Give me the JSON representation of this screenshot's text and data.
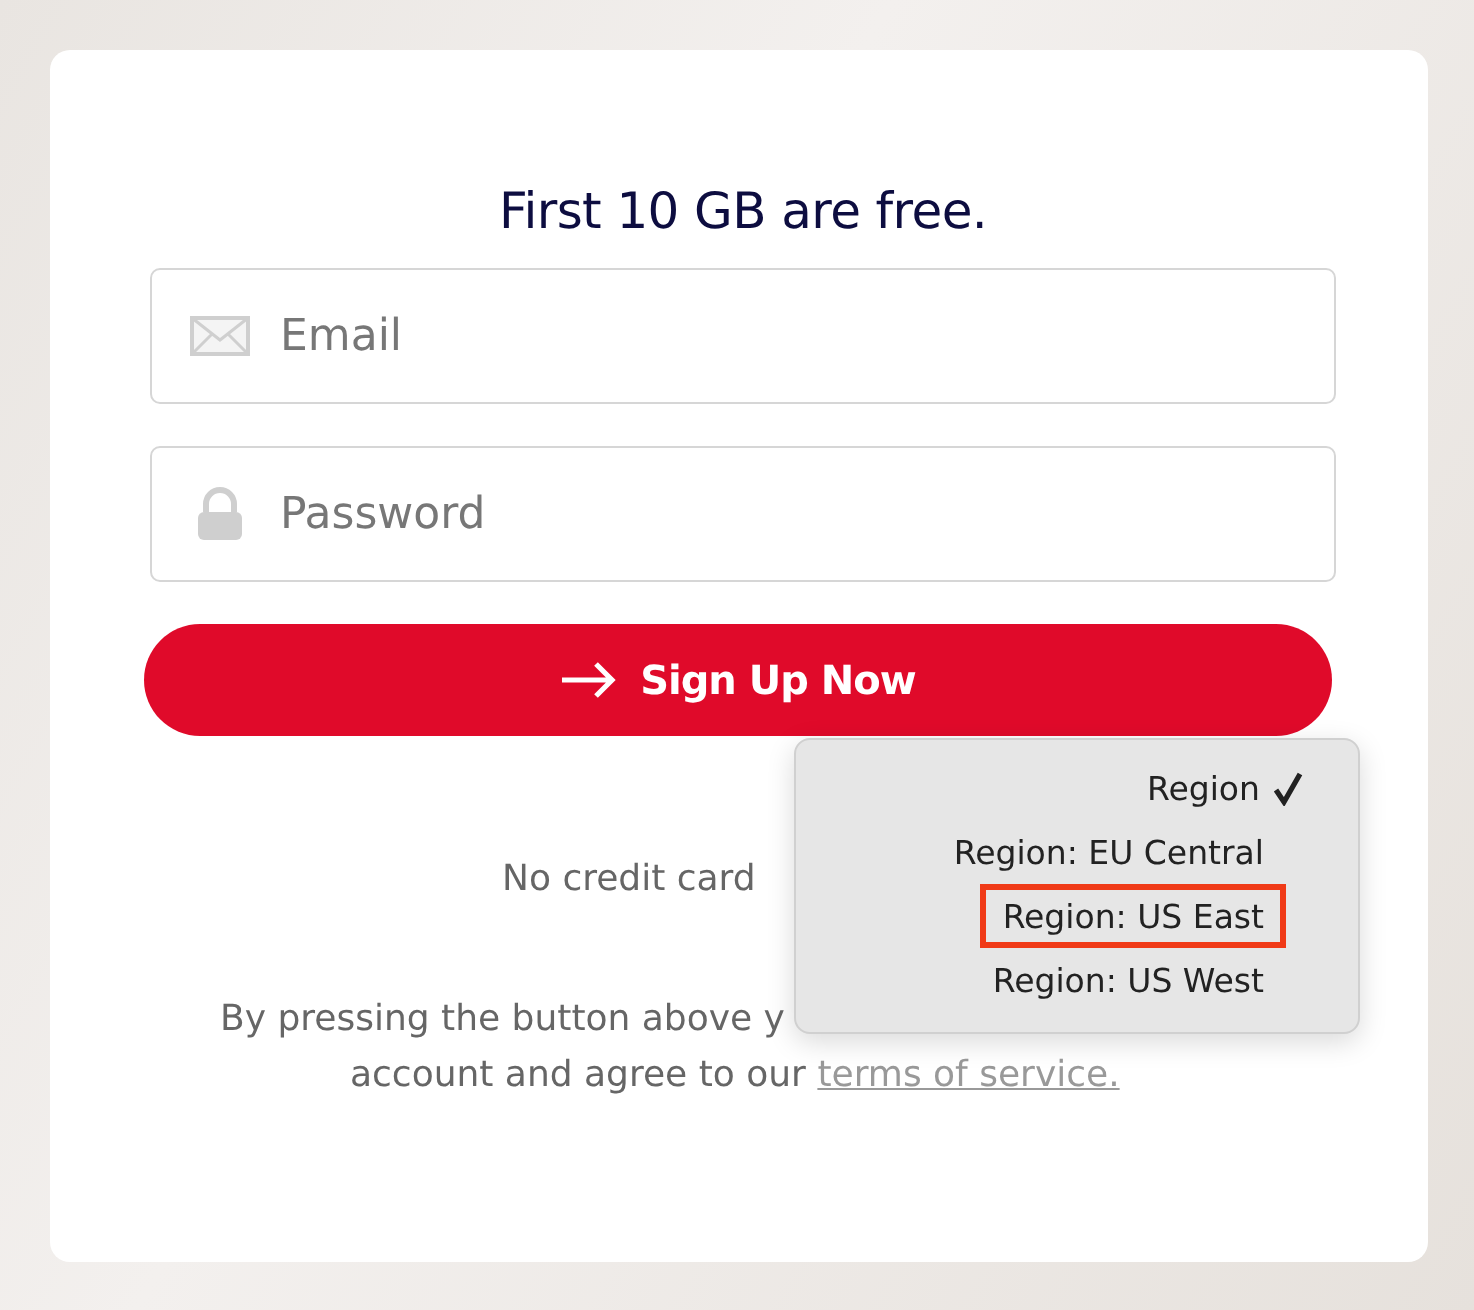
{
  "title": "First 10 GB are free.",
  "fields": [
    {
      "kind": "email",
      "placeholder": "Email"
    },
    {
      "kind": "password",
      "placeholder": "Password"
    }
  ],
  "submit": {
    "label": "Sign Up Now"
  },
  "notes": [
    {
      "kind": "note",
      "text": "No credit card"
    },
    {
      "kind": "terms",
      "text": "By pressing the button above y"
    },
    {
      "kind": "terms-end",
      "text": "account and agree to our ",
      "link": "terms of service."
    }
  ],
  "region_menu": {
    "items": [
      {
        "label": "Region",
        "checked": true,
        "highlighted": false
      },
      {
        "label": "Region: EU Central",
        "checked": false,
        "highlighted": false
      },
      {
        "label": "Region: US East",
        "checked": false,
        "highlighted": true
      },
      {
        "label": "Region: US West",
        "checked": false,
        "highlighted": false
      }
    ]
  }
}
